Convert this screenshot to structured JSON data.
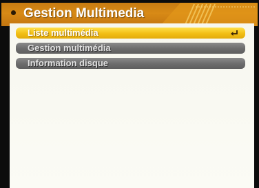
{
  "header": {
    "title": "Gestion Multimedia"
  },
  "menu": {
    "items": [
      {
        "label": "Liste multimédia",
        "selected": true,
        "icon": "enter-icon"
      },
      {
        "label": "Gestion multimédia",
        "selected": false
      },
      {
        "label": "Information disque",
        "selected": false
      }
    ]
  },
  "colors": {
    "header_orange": "#d88a16",
    "selected_yellow": "#f2be14",
    "item_gray": "#6c6c6c",
    "panel_bg": "#f9f9f2"
  }
}
